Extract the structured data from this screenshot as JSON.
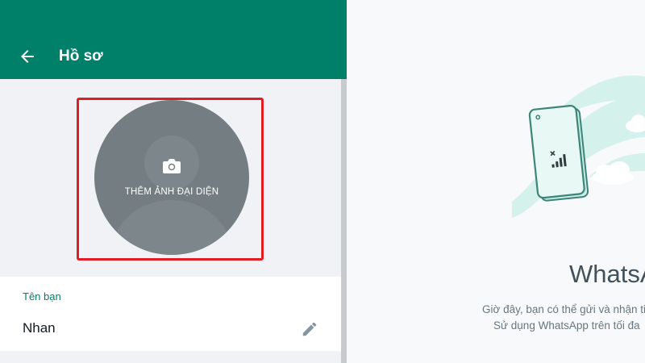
{
  "profile": {
    "title": "Hồ sơ",
    "back_icon": "arrow-left-icon",
    "avatar": {
      "add_photo_label": "THÊM ẢNH ĐẠI DIỆN",
      "camera_icon": "camera-icon"
    },
    "name_section": {
      "label": "Tên bạn",
      "value": "Nhan",
      "edit_icon": "pencil-icon"
    }
  },
  "intro": {
    "title": "WhatsA",
    "line1": "Giờ đây, bạn có thể gửi và nhận ti",
    "line2": "Sử dụng WhatsApp trên tối đa"
  },
  "colors": {
    "header": "#008069",
    "accent": "#008069",
    "highlight_border": "#e01c24",
    "avatar_bg": "#737d82"
  }
}
